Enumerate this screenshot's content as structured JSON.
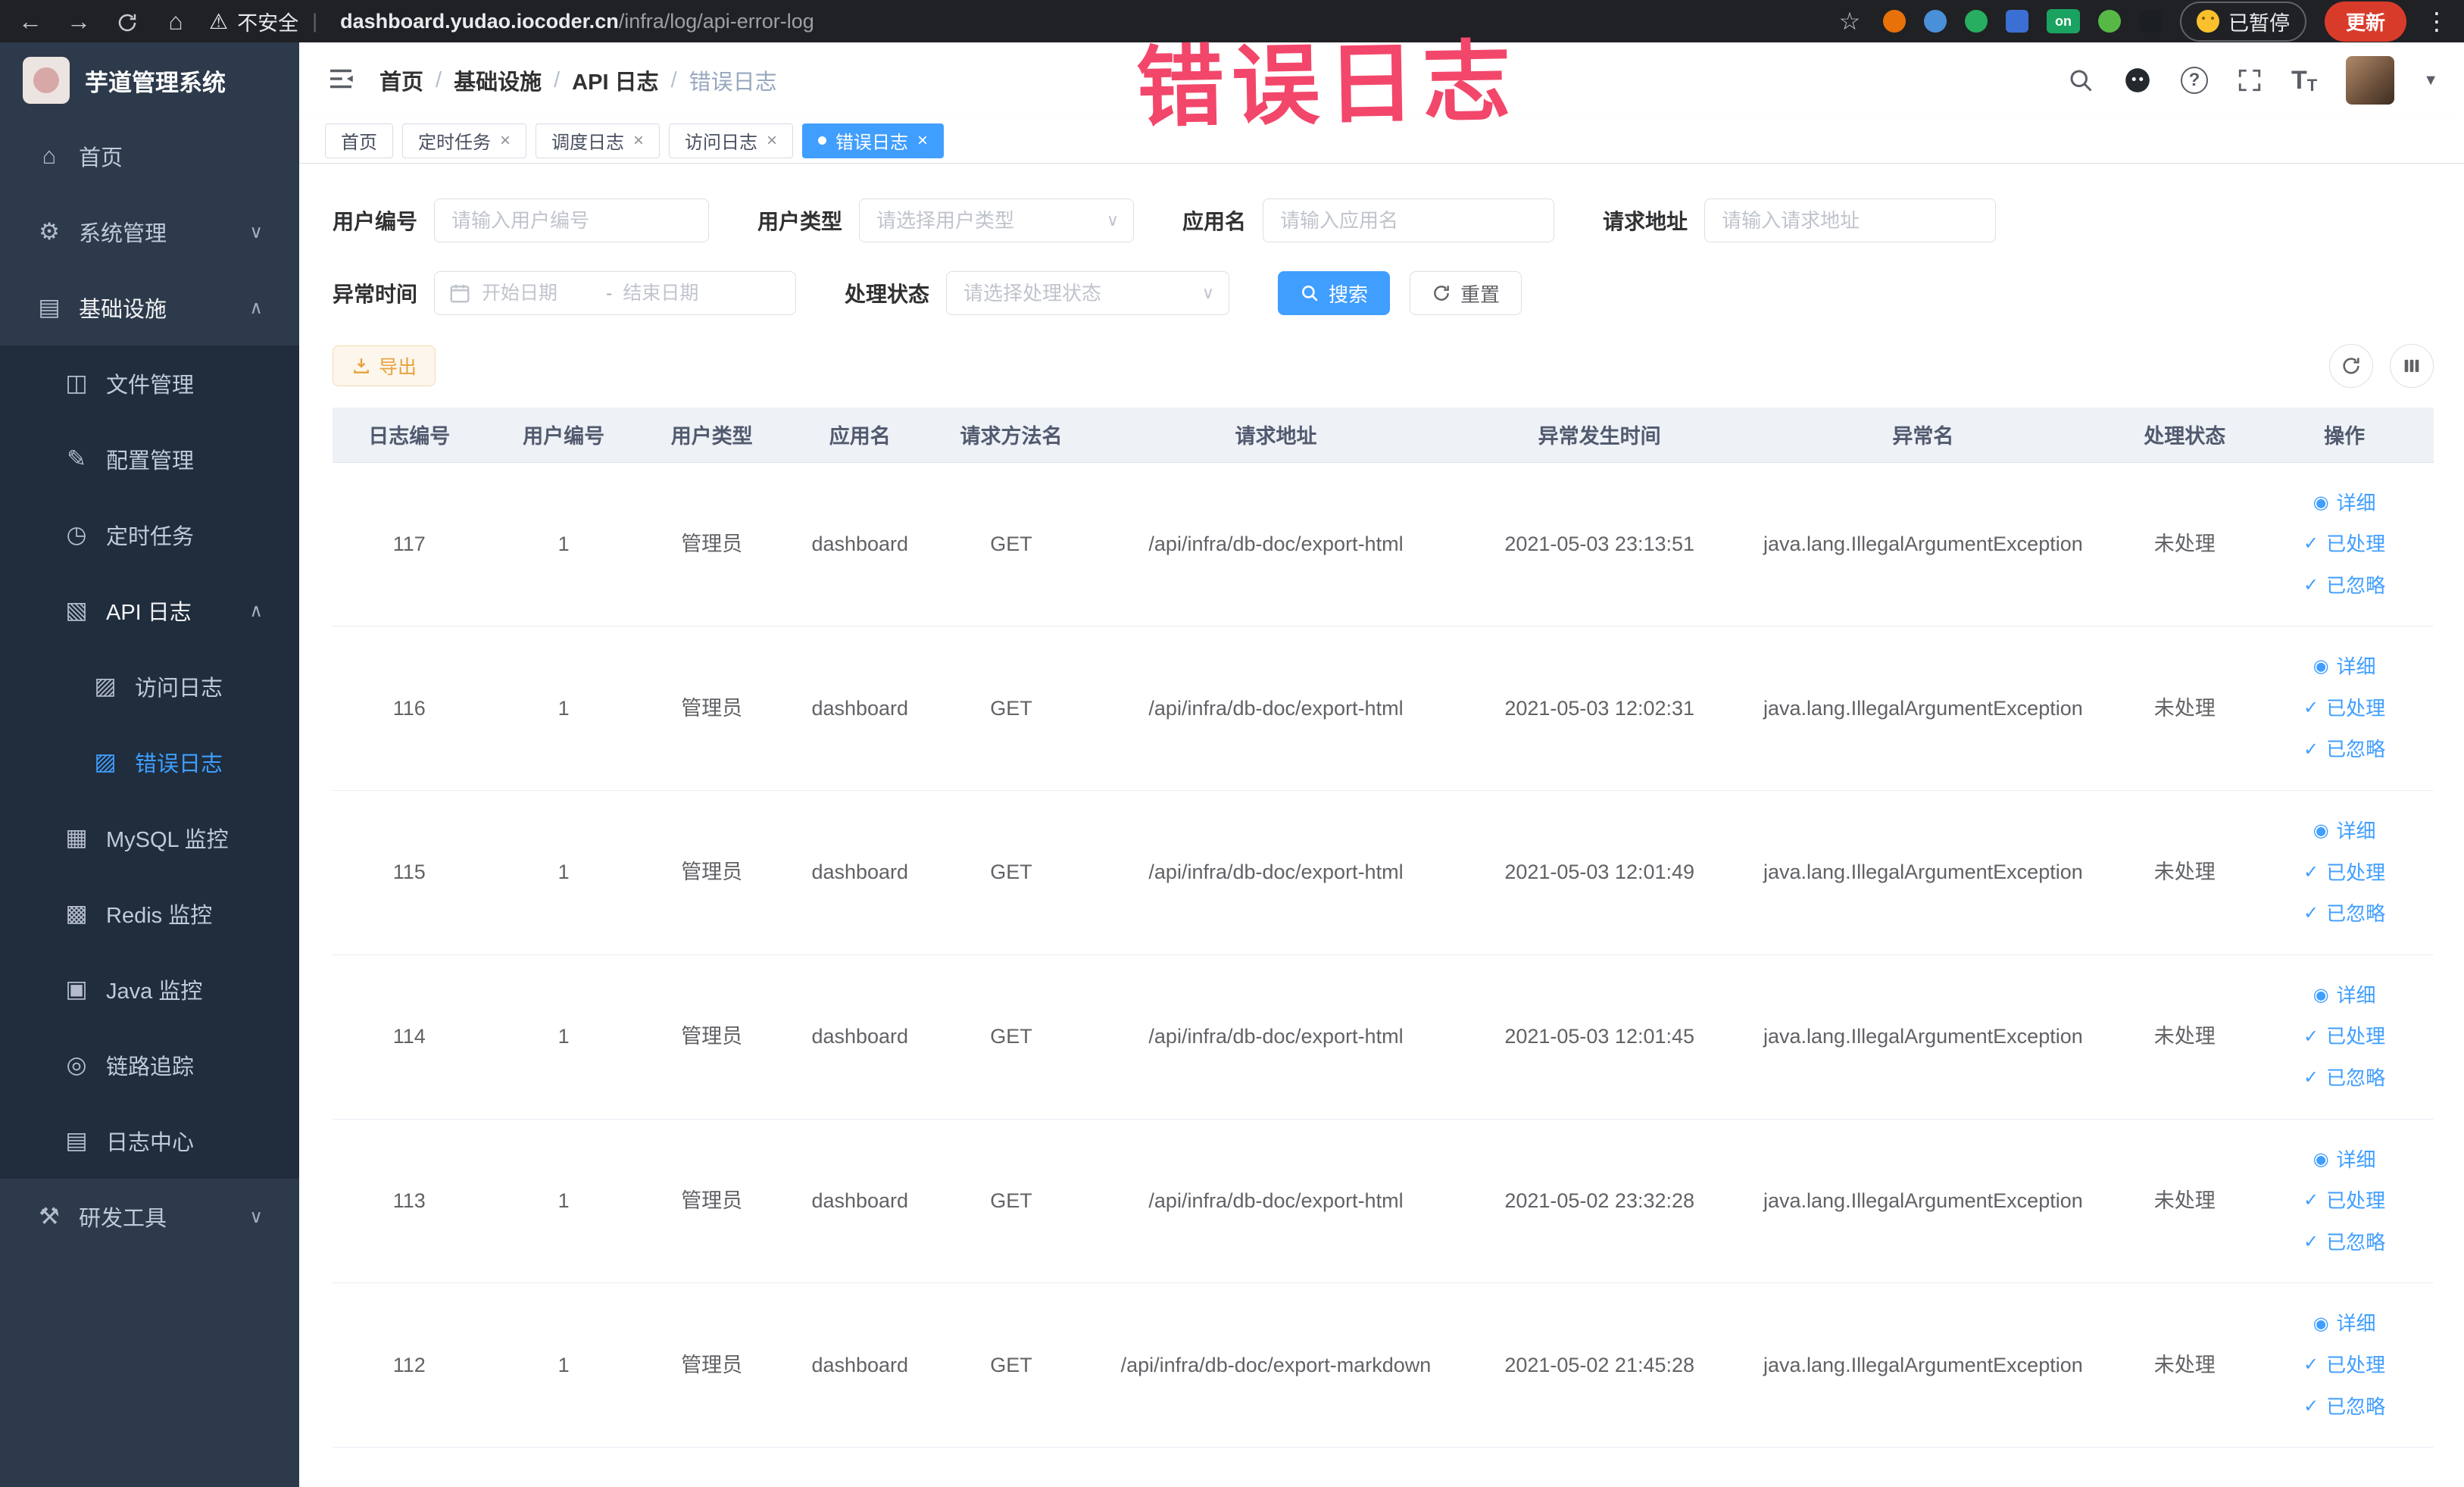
{
  "browser": {
    "security_label": "不安全",
    "url_host": "dashboard.yudao.iocoder.cn",
    "url_path": "/infra/log/api-error-log",
    "extension_on_badge": "on",
    "paused_badge": "已暂停",
    "update_button": "更新"
  },
  "annotation": {
    "text": "错误日志"
  },
  "sidebar": {
    "logo_title": "芋道管理系统",
    "items": [
      {
        "key": "home",
        "label": "首页",
        "icon": "home-icon",
        "glyph": "⌂",
        "level": 1
      },
      {
        "key": "system",
        "label": "系统管理",
        "icon": "gear-icon",
        "glyph": "⚙",
        "level": 1,
        "chevron": "down"
      },
      {
        "key": "infra",
        "label": "基础设施",
        "icon": "infra-icon",
        "glyph": "▤",
        "level": 1,
        "chevron": "up",
        "open": true
      },
      {
        "key": "file",
        "label": "文件管理",
        "icon": "file-icon",
        "glyph": "◫",
        "level": 2,
        "nested": true
      },
      {
        "key": "config",
        "label": "配置管理",
        "icon": "config-icon",
        "glyph": "✎",
        "level": 2,
        "nested": true
      },
      {
        "key": "job",
        "label": "定时任务",
        "icon": "timer-icon",
        "glyph": "◷",
        "level": 2,
        "nested": true
      },
      {
        "key": "api-log",
        "label": "API 日志",
        "icon": "api-log-icon",
        "glyph": "▧",
        "level": 2,
        "nested": true,
        "chevron": "up",
        "open": true
      },
      {
        "key": "access-log",
        "label": "访问日志",
        "icon": "access-log-icon",
        "glyph": "▨",
        "level": 3,
        "nested": true
      },
      {
        "key": "error-log",
        "label": "错误日志",
        "icon": "error-log-icon",
        "glyph": "▨",
        "level": 3,
        "nested": true,
        "active": true
      },
      {
        "key": "mysql",
        "label": "MySQL 监控",
        "icon": "mysql-icon",
        "glyph": "▦",
        "level": 2,
        "nested": true
      },
      {
        "key": "redis",
        "label": "Redis 监控",
        "icon": "redis-icon",
        "glyph": "▩",
        "level": 2,
        "nested": true
      },
      {
        "key": "java",
        "label": "Java 监控",
        "icon": "java-icon",
        "glyph": "▣",
        "level": 2,
        "nested": true
      },
      {
        "key": "trace",
        "label": "链路追踪",
        "icon": "trace-icon",
        "glyph": "◎",
        "level": 2,
        "nested": true
      },
      {
        "key": "log-center",
        "label": "日志中心",
        "icon": "log-center-icon",
        "glyph": "▤",
        "level": 2,
        "nested": true
      },
      {
        "key": "dev-tools",
        "label": "研发工具",
        "icon": "tools-icon",
        "glyph": "⚒",
        "level": 1,
        "chevron": "down"
      }
    ]
  },
  "breadcrumb": [
    "首页",
    "基础设施",
    "API 日志",
    "错误日志"
  ],
  "tabs": [
    {
      "label": "首页",
      "closable": false,
      "active": false
    },
    {
      "label": "定时任务",
      "closable": true,
      "active": false
    },
    {
      "label": "调度日志",
      "closable": true,
      "active": false
    },
    {
      "label": "访问日志",
      "closable": true,
      "active": false
    },
    {
      "label": "错误日志",
      "closable": true,
      "active": true
    }
  ],
  "filters": {
    "user_id": {
      "label": "用户编号",
      "placeholder": "请输入用户编号"
    },
    "user_type": {
      "label": "用户类型",
      "placeholder": "请选择用户类型"
    },
    "app_name": {
      "label": "应用名",
      "placeholder": "请输入应用名"
    },
    "request_url": {
      "label": "请求地址",
      "placeholder": "请输入请求地址"
    },
    "exception_time": {
      "label": "异常时间",
      "start_placeholder": "开始日期",
      "separator": "-",
      "end_placeholder": "结束日期"
    },
    "process_status": {
      "label": "处理状态",
      "placeholder": "请选择处理状态"
    },
    "search_label": "搜索",
    "reset_label": "重置"
  },
  "toolbar": {
    "export_label": "导出"
  },
  "table": {
    "headers": [
      "日志编号",
      "用户编号",
      "用户类型",
      "应用名",
      "请求方法名",
      "请求地址",
      "异常发生时间",
      "异常名",
      "处理状态",
      "操作"
    ],
    "action_labels": [
      {
        "label": "详细",
        "icon": "eye-icon",
        "glyph": "◉"
      },
      {
        "label": "已处理",
        "icon": "check-icon",
        "glyph": "✓"
      },
      {
        "label": "已忽略",
        "icon": "check-icon",
        "glyph": "✓"
      }
    ],
    "rows": [
      {
        "id": "117",
        "user_id": "1",
        "user_type": "管理员",
        "app": "dashboard",
        "method": "GET",
        "url": "/api/infra/db-doc/export-html",
        "time": "2021-05-03 23:13:51",
        "exception": "java.lang.IllegalArgumentException",
        "status": "未处理"
      },
      {
        "id": "116",
        "user_id": "1",
        "user_type": "管理员",
        "app": "dashboard",
        "method": "GET",
        "url": "/api/infra/db-doc/export-html",
        "time": "2021-05-03 12:02:31",
        "exception": "java.lang.IllegalArgumentException",
        "status": "未处理"
      },
      {
        "id": "115",
        "user_id": "1",
        "user_type": "管理员",
        "app": "dashboard",
        "method": "GET",
        "url": "/api/infra/db-doc/export-html",
        "time": "2021-05-03 12:01:49",
        "exception": "java.lang.IllegalArgumentException",
        "status": "未处理"
      },
      {
        "id": "114",
        "user_id": "1",
        "user_type": "管理员",
        "app": "dashboard",
        "method": "GET",
        "url": "/api/infra/db-doc/export-html",
        "time": "2021-05-03 12:01:45",
        "exception": "java.lang.IllegalArgumentException",
        "status": "未处理"
      },
      {
        "id": "113",
        "user_id": "1",
        "user_type": "管理员",
        "app": "dashboard",
        "method": "GET",
        "url": "/api/infra/db-doc/export-html",
        "time": "2021-05-02 23:32:28",
        "exception": "java.lang.IllegalArgumentException",
        "status": "未处理"
      },
      {
        "id": "112",
        "user_id": "1",
        "user_type": "管理员",
        "app": "dashboard",
        "method": "GET",
        "url": "/api/infra/db-doc/export-markdown",
        "time": "2021-05-02 21:45:28",
        "exception": "java.lang.IllegalArgumentException",
        "status": "未处理"
      }
    ]
  }
}
